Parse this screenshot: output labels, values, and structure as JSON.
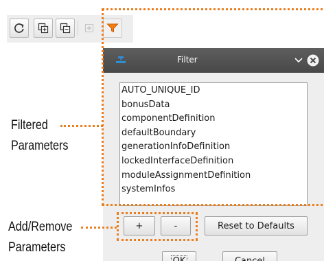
{
  "toolbar": {
    "buttons": [
      {
        "name": "refresh",
        "icon": "refresh-icon"
      },
      {
        "name": "expand-all",
        "icon": "expand-all-icon"
      },
      {
        "name": "collapse-all",
        "icon": "collapse-all-icon"
      },
      {
        "name": "add",
        "icon": "plus-icon",
        "disabled": true
      },
      {
        "name": "filter",
        "icon": "filter-icon",
        "selected": true
      }
    ]
  },
  "dialog": {
    "title": "Filter",
    "list_items": [
      "AUTO_UNIQUE_ID",
      "bonusData",
      "componentDefinition",
      "defaultBoundary",
      "generationInfoDefinition",
      "lockedInterfaceDefinition",
      "moduleAssignmentDefinition",
      "systemInfos"
    ],
    "add_label": "+",
    "remove_label": "-",
    "reset_label": "Reset to Defaults",
    "ok_label": "OK",
    "cancel_label": "Cancel"
  },
  "annotations": {
    "filtered": [
      "Filtered",
      "Parameters"
    ],
    "add_remove": [
      "Add/Remove",
      "Parameters"
    ],
    "color": "#ea7e1e"
  },
  "colors": {
    "filter_icon": "#f57f17",
    "titlebar": "#505050",
    "dialog_bg": "#eeeeee"
  }
}
